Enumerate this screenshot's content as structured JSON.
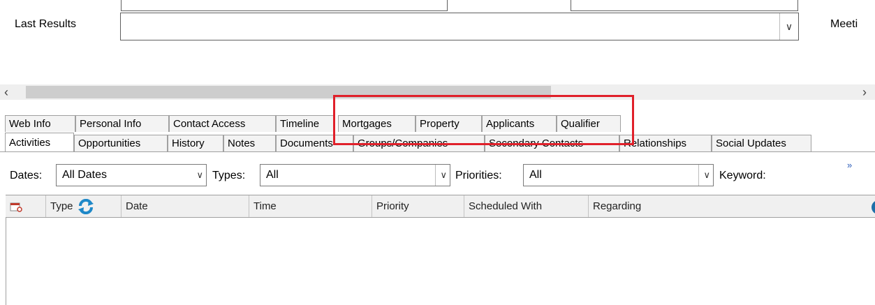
{
  "form": {
    "last_results_label": "Last Results",
    "last_results_value": "",
    "meeting_label_fragment": "Meeti"
  },
  "tabs_row1": [
    "Web Info",
    "Personal Info",
    "Contact Access",
    "Timeline",
    "Mortgages",
    "Property",
    "Applicants",
    "Qualifier"
  ],
  "tabs_row2": [
    "Activities",
    "Opportunities",
    "History",
    "Notes",
    "Documents",
    "Groups/Companies",
    "Secondary Contacts",
    "Relationships",
    "Social Updates"
  ],
  "active_tab": "Activities",
  "filters": {
    "dates_label": "Dates:",
    "dates_value": "All Dates",
    "types_label": "Types:",
    "types_value": "All",
    "priorities_label": "Priorities:",
    "priorities_value": "All",
    "keyword_label": "Keyword:",
    "overflow_glyph": "»"
  },
  "grid": {
    "columns": [
      "Type",
      "Date",
      "Time",
      "Priority",
      "Scheduled With",
      "Regarding"
    ],
    "rows": []
  },
  "colors": {
    "highlight": "#e0202a",
    "refresh_icon": "#1e88c8",
    "calendar_icon": "#c0392b"
  }
}
